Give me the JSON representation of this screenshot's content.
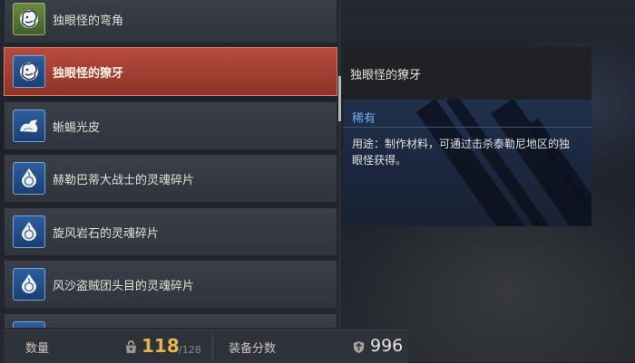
{
  "items": [
    {
      "label": "独眼怪的弯角",
      "icon": "lion-head-icon",
      "icon_color": "green",
      "selected": false
    },
    {
      "label": "独眼怪的獠牙",
      "icon": "lion-head-icon",
      "icon_color": "blue",
      "selected": true
    },
    {
      "label": "蜥蜴光皮",
      "icon": "lizard-hide-icon",
      "icon_color": "blue",
      "selected": false
    },
    {
      "label": "赫勒巴蒂大战士的灵魂碎片",
      "icon": "soul-flame-icon",
      "icon_color": "blue",
      "selected": false
    },
    {
      "label": "旋风岩石的灵魂碎片",
      "icon": "soul-flame-icon",
      "icon_color": "blue",
      "selected": false
    },
    {
      "label": "风沙盗贼团头目的灵魂碎片",
      "icon": "soul-flame-icon",
      "icon_color": "blue",
      "selected": false
    },
    {
      "label": "",
      "icon": "soul-flame-icon",
      "icon_color": "blue",
      "selected": false
    }
  ],
  "detail": {
    "title": "独眼怪的獠牙",
    "rarity": "稀有",
    "description": "用途：制作材料，可通过击杀泰勒尼地区的独眼怪获得。"
  },
  "footer": {
    "count_label": "数量",
    "count_value": "118",
    "count_max": "/128",
    "score_label": "装备分数",
    "score_value": "996"
  },
  "colors": {
    "selected_item": "#b64b3e",
    "rarity_rare": "#6fb0f0",
    "count_value": "#e6b44c"
  }
}
